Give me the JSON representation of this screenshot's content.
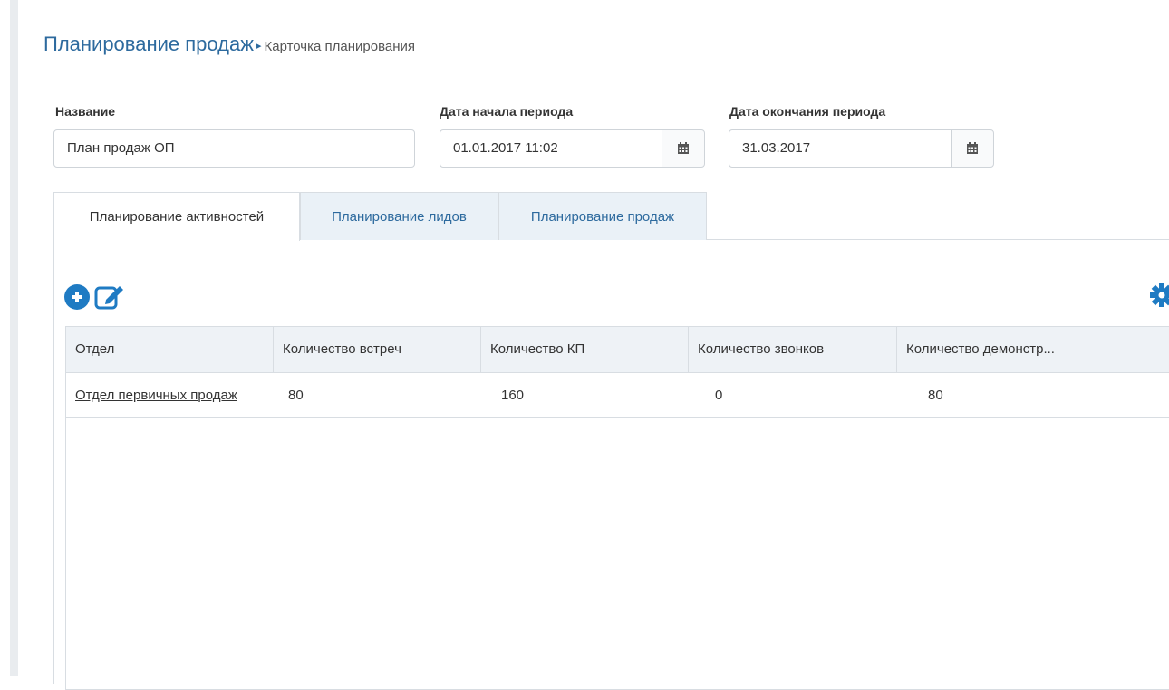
{
  "breadcrumb": {
    "section": "Планирование продаж",
    "separator": "▸",
    "page": "Карточка планирования"
  },
  "form": {
    "name": {
      "label": "Название",
      "value": "План продаж ОП"
    },
    "start_date": {
      "label": "Дата начала периода",
      "value": "01.01.2017 11:02",
      "icon": "calendar-icon"
    },
    "end_date": {
      "label": "Дата окончания периода",
      "value": "31.03.2017",
      "icon": "calendar-icon"
    }
  },
  "tabs": [
    {
      "label": "Планирование активностей",
      "active": true
    },
    {
      "label": "Планирование лидов",
      "active": false
    },
    {
      "label": "Планирование продаж",
      "active": false
    }
  ],
  "toolbar": {
    "add_icon": "plus-circle-icon",
    "edit_icon": "edit-icon",
    "settings_icon": "gear-icon"
  },
  "table": {
    "columns": [
      "Отдел",
      "Количество встреч",
      "Количество КП",
      "Количество звонков",
      "Количество демонстр..."
    ],
    "rows": [
      [
        "Отдел первичных продаж",
        "80",
        "160",
        "0",
        "80"
      ]
    ]
  },
  "colors": {
    "accent": "#1f7bc3",
    "link_blue": "#2d6a9e",
    "header_bg": "#eef2f6",
    "tab_inactive_bg": "#eaf1f7"
  }
}
